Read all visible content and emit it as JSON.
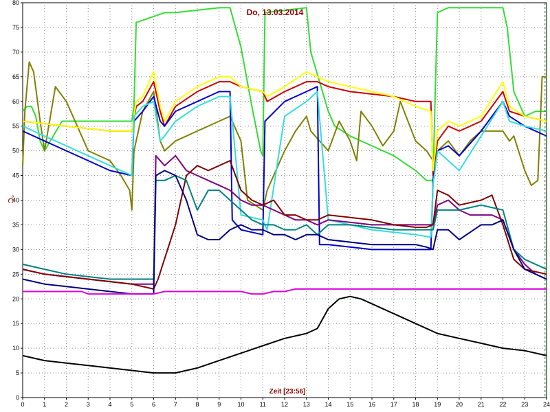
{
  "chart_data": {
    "type": "line",
    "title": "Do, 13.03.2014",
    "xlabel": "Zeit [23:56]",
    "ylabel": "°C",
    "xlim": [
      0,
      24
    ],
    "ylim": [
      0,
      80
    ],
    "x_ticks": [
      "0",
      "1",
      "2",
      "3",
      "4",
      "5",
      "6",
      "7",
      "8",
      "9",
      "10",
      "11",
      "12",
      "13",
      "14",
      "15",
      "16",
      "17",
      "18",
      "19",
      "20",
      "21",
      "22",
      "23",
      "24"
    ],
    "y_ticks": [
      "0",
      "5",
      "10",
      "15",
      "20",
      "25",
      "30",
      "35",
      "40",
      "45",
      "50",
      "55",
      "60",
      "65",
      "70",
      "75",
      "80"
    ],
    "grid": true,
    "grid_style": "dotted",
    "current_time_marker": 23.93,
    "series": [
      {
        "color": "#33dd33",
        "x": [
          0,
          0.2,
          0.4,
          0.6,
          0.8,
          1,
          1.8,
          2,
          3,
          4,
          5,
          5.1,
          5.2,
          6.5,
          7,
          9,
          9.5,
          10,
          10.5,
          10.9,
          11,
          11.1,
          13,
          13.2,
          14,
          14.3,
          15,
          16,
          17,
          18,
          18.5,
          18.8,
          18.9,
          19,
          19.5,
          20,
          22,
          22.2,
          22.5,
          23,
          23.5,
          24
        ],
        "values": [
          58,
          59,
          59,
          57,
          52,
          50,
          56,
          56,
          56,
          56,
          56,
          59,
          76,
          78,
          78,
          79,
          79,
          71,
          59,
          50,
          49,
          78,
          79,
          70,
          58,
          55,
          53,
          51,
          49,
          46,
          44,
          44,
          62,
          78,
          79,
          79,
          79,
          75,
          62,
          57,
          58,
          58
        ]
      },
      {
        "color": "#808000",
        "x": [
          0,
          0.1,
          0.3,
          0.5,
          0.8,
          1,
          1.5,
          2,
          2.5,
          3,
          4,
          4.5,
          4.9,
          5,
          5.1,
          5.5,
          6,
          6.3,
          6.5,
          7,
          8,
          9,
          9.5,
          10,
          10.3,
          11,
          11.2,
          12,
          12.5,
          13,
          13.2,
          14,
          14.5,
          15,
          15.3,
          15.5,
          16,
          16.5,
          17,
          17.3,
          18,
          18.5,
          18.8,
          19,
          19.5,
          20,
          20.5,
          21,
          22,
          22.3,
          22.5,
          23,
          23.3,
          23.6,
          23.8,
          24
        ],
        "values": [
          47,
          58,
          68,
          66,
          56,
          50,
          63,
          60,
          55,
          50,
          48,
          45,
          42,
          38,
          50,
          58,
          62,
          52,
          50,
          52,
          54,
          56,
          57,
          52,
          40,
          38,
          42,
          50,
          54,
          57,
          54,
          50,
          56,
          52,
          48,
          58,
          55,
          51,
          54,
          60,
          52,
          50,
          48,
          50,
          52,
          49,
          52,
          54,
          54,
          52,
          53,
          46,
          43,
          44,
          65,
          65
        ]
      },
      {
        "color": "#cc0000",
        "x": [
          0,
          1,
          2,
          3,
          4,
          5,
          5.2,
          5.5,
          6,
          6.3,
          6.5,
          7,
          8,
          9,
          9.5,
          10,
          11,
          11.2,
          12,
          13,
          13.5,
          14,
          15,
          16,
          17,
          18,
          18.7,
          18.8,
          19,
          19.5,
          20,
          21,
          22,
          22.3,
          23,
          24
        ],
        "values": [
          56,
          55.5,
          55,
          54.5,
          54,
          54,
          59,
          60,
          64,
          58,
          55,
          59,
          62,
          64,
          64,
          63,
          62,
          60,
          62,
          64,
          64,
          63,
          62,
          61.5,
          61,
          60,
          60,
          45,
          52,
          55,
          54,
          56,
          62,
          58,
          57,
          56
        ]
      },
      {
        "color": "#ffff00",
        "x": [
          0,
          1,
          2,
          3,
          4,
          5,
          5.2,
          5.5,
          6,
          6.3,
          6.5,
          7,
          8,
          9,
          9.5,
          10,
          11,
          11.2,
          12,
          13,
          13.5,
          14,
          15,
          16,
          17,
          18,
          18.7,
          18.8,
          19,
          19.5,
          20,
          21,
          22,
          22.3,
          23,
          24
        ],
        "values": [
          56,
          55.5,
          55,
          54.5,
          54,
          54,
          60,
          61,
          66,
          59,
          56,
          60,
          63,
          65,
          65,
          63,
          62,
          61,
          63,
          66,
          65,
          64,
          63,
          62,
          61,
          59,
          58,
          46,
          54,
          56,
          55,
          57,
          64,
          59,
          57,
          56
        ]
      },
      {
        "color": "#0000cc",
        "x": [
          0,
          1,
          2,
          3,
          4,
          5,
          5.1,
          5.5,
          6,
          6.3,
          6.5,
          7,
          8,
          9,
          9.5,
          9.6,
          10,
          11,
          11.1,
          12,
          13,
          13.5,
          13.6,
          14,
          15,
          16,
          17,
          18,
          18.7,
          18.8,
          19,
          19.5,
          20,
          21,
          22,
          22.3,
          23,
          24
        ],
        "values": [
          54,
          52,
          50,
          48,
          46,
          45,
          56,
          58,
          61,
          56,
          55,
          58,
          60,
          62,
          62,
          36,
          34,
          33,
          56,
          60,
          62,
          63,
          31,
          31,
          30.5,
          30,
          30,
          30,
          30,
          44,
          50,
          51,
          49,
          54,
          60,
          57,
          55,
          53
        ]
      },
      {
        "color": "#33dddd",
        "x": [
          0,
          1,
          2,
          3,
          4,
          5,
          5.1,
          5.5,
          6,
          6.3,
          6.5,
          7,
          8,
          9,
          9.5,
          10,
          11,
          11.2,
          12,
          13,
          13.5,
          14,
          15,
          16,
          17,
          18,
          18.7,
          18.8,
          19,
          19.5,
          20,
          21,
          22,
          22.3,
          23,
          24
        ],
        "values": [
          55,
          53,
          51,
          49,
          47,
          45,
          57,
          59,
          60,
          52,
          53,
          56,
          59,
          61,
          61,
          37,
          36,
          34,
          57,
          60,
          62,
          36,
          35,
          34,
          33.5,
          33,
          32.5,
          43,
          50,
          48,
          46,
          53,
          60,
          56,
          55,
          54
        ]
      },
      {
        "color": "#800080",
        "x": [
          0,
          1,
          2,
          3,
          4,
          5,
          6,
          6.1,
          6.5,
          7,
          7.5,
          8,
          8.5,
          9,
          9.5,
          10,
          10.5,
          11,
          11.5,
          12,
          12.5,
          13,
          13.5,
          14,
          15,
          16,
          17,
          18,
          18.5,
          18.8,
          19,
          19.5,
          20,
          20.5,
          21,
          21.5,
          22,
          22.5,
          23,
          23.5,
          24
        ],
        "values": [
          26,
          25,
          24.5,
          24,
          23.5,
          23,
          23,
          49,
          47,
          49,
          46,
          45,
          44,
          43,
          42,
          40,
          39,
          39,
          38,
          37,
          36,
          36,
          35,
          36,
          35.5,
          35,
          35,
          35,
          35,
          35,
          39,
          40,
          38,
          37,
          37,
          37,
          36,
          30,
          27,
          25,
          24
        ]
      },
      {
        "color": "#800000",
        "x": [
          0,
          1,
          2,
          3,
          4,
          5,
          6,
          6.2,
          7,
          7.5,
          8,
          8.5,
          9,
          9.5,
          10,
          10.5,
          11,
          11.5,
          12,
          12.5,
          13,
          13.5,
          14,
          15,
          16,
          17,
          18,
          18.5,
          18.8,
          19,
          19.5,
          20,
          21,
          21.5,
          22,
          22.5,
          23,
          24
        ],
        "values": [
          26,
          25,
          24.5,
          24,
          23.5,
          23,
          22,
          24,
          35,
          45,
          47,
          46,
          47,
          48,
          42,
          40,
          39,
          40,
          37,
          37,
          36,
          36,
          37,
          36.5,
          36,
          35,
          34.5,
          34.5,
          35,
          42,
          41,
          39,
          40,
          41,
          35,
          28,
          26,
          25
        ]
      },
      {
        "color": "#008080",
        "x": [
          0,
          1,
          2,
          3,
          4,
          5,
          6,
          6.1,
          6.5,
          7,
          7.5,
          8,
          8.5,
          9,
          9.5,
          10,
          10.5,
          11,
          11.5,
          12,
          12.5,
          13,
          13.5,
          14,
          15,
          16,
          17,
          18,
          18.5,
          18.8,
          19,
          19.5,
          20,
          21,
          22,
          22.5,
          23,
          24
        ],
        "values": [
          27,
          26,
          25,
          24.5,
          24,
          24,
          24,
          44,
          44,
          45,
          44,
          38,
          42,
          42,
          40,
          38,
          36,
          35,
          35,
          34,
          34,
          35,
          33,
          35,
          35,
          34.5,
          34,
          34,
          34,
          34,
          38,
          38,
          38,
          39,
          38,
          30,
          28,
          26
        ]
      },
      {
        "color": "#000080",
        "x": [
          0,
          1,
          2,
          3,
          4,
          5,
          6,
          6.1,
          6.5,
          7,
          7.5,
          8,
          8.5,
          9,
          9.5,
          10,
          10.5,
          11,
          11.5,
          12,
          12.5,
          13,
          13.5,
          14,
          15,
          16,
          17,
          18,
          18.5,
          18.8,
          19,
          19.5,
          20,
          21,
          21.5,
          22,
          22.5,
          23,
          24
        ],
        "values": [
          24,
          23,
          22.5,
          22,
          21.5,
          21,
          21,
          45,
          46,
          45,
          40,
          33,
          32,
          32,
          34,
          35,
          34,
          34,
          33,
          33,
          32,
          33,
          33,
          32,
          31.5,
          31,
          31,
          31,
          30.5,
          30,
          34,
          34,
          32,
          35,
          35,
          36,
          30,
          26,
          24
        ]
      },
      {
        "color": "#dd00dd",
        "x": [
          0,
          2.7,
          3,
          6,
          6.5,
          10,
          10.5,
          11,
          11.5,
          12,
          12.5,
          24
        ],
        "values": [
          21.5,
          21.5,
          21,
          21,
          21.5,
          21.5,
          21,
          21,
          21.5,
          21.5,
          22,
          22
        ]
      },
      {
        "color": "#000000",
        "x": [
          0,
          1,
          2,
          3,
          4,
          5,
          6,
          7,
          8,
          9,
          10,
          11,
          12,
          13,
          13.5,
          14,
          14.5,
          15,
          15.5,
          16,
          17,
          18,
          19,
          20,
          21,
          22,
          23,
          24
        ],
        "values": [
          8.5,
          7.5,
          7,
          6.5,
          6,
          5.5,
          5,
          5,
          6,
          7.5,
          9,
          10.5,
          12,
          13,
          14,
          18,
          20,
          20.5,
          20,
          19,
          17,
          15,
          13,
          12,
          11,
          10,
          9.5,
          8.5
        ]
      }
    ]
  }
}
